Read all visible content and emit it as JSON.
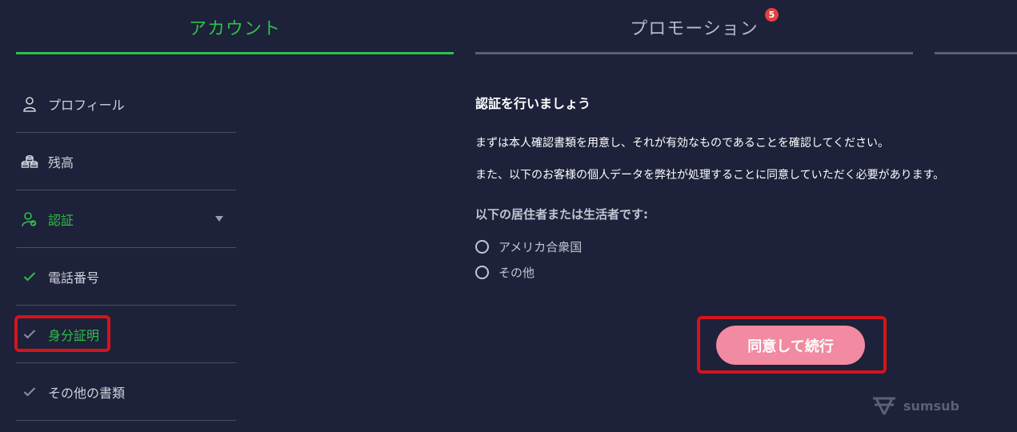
{
  "tabs": [
    {
      "label": "アカウント",
      "active": true
    },
    {
      "label": "プロモーション",
      "badge": "5"
    },
    {
      "label": ""
    }
  ],
  "sidebar": {
    "items": [
      {
        "label": "プロフィール",
        "icon": "user-icon"
      },
      {
        "label": "残高",
        "icon": "coins-icon"
      },
      {
        "label": "認証",
        "icon": "user-check-icon",
        "active": true,
        "expanded": true
      },
      {
        "label": "電話番号",
        "icon": "check-icon",
        "status": "verified"
      },
      {
        "label": "身分証明",
        "icon": "check-icon",
        "active": true
      },
      {
        "label": "その他の書類",
        "icon": "check-icon"
      }
    ]
  },
  "main": {
    "heading": "認証を行いましょう",
    "para1": "まずは本人確認書類を用意し、それが有効なものであることを確認してください。",
    "para2": "また、以下のお客様の個人データを弊社が処理することに同意していただく必要があります。",
    "question": "以下の居住者または生活者です:",
    "options": [
      "アメリカ合衆国",
      "その他"
    ],
    "continue_label": "同意して続行"
  },
  "brand": {
    "name": "sumsub"
  },
  "colors": {
    "background": "#1d2139",
    "accent_green": "#2fbf4a",
    "button_pink": "#f28aa1",
    "highlight_red": "#d3141b",
    "badge_red": "#e2413f"
  }
}
